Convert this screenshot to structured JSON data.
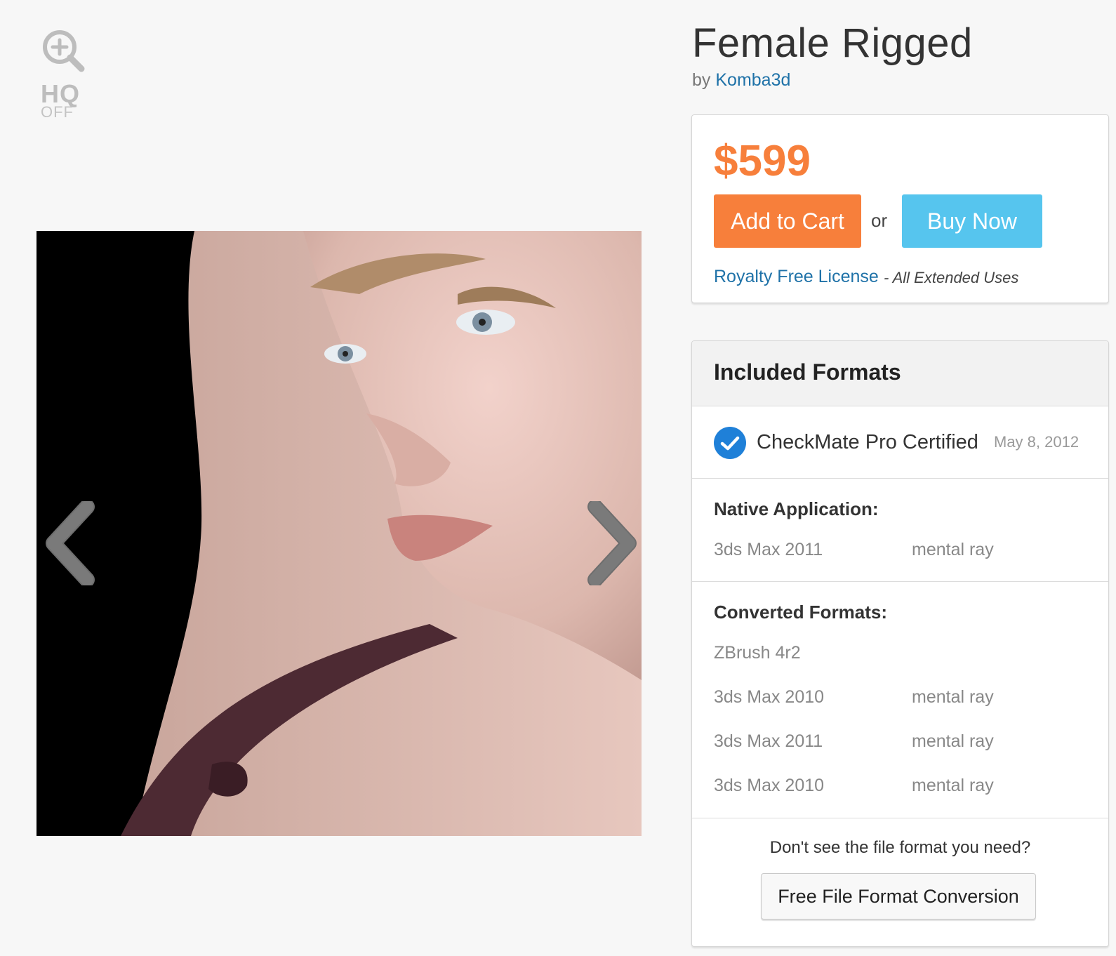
{
  "zoom": {
    "icon": "zoom-in-icon",
    "hq_label": "HQ",
    "hq_state": "OFF"
  },
  "viewer": {
    "prev_icon": "chevron-left-icon",
    "next_icon": "chevron-right-icon"
  },
  "product": {
    "title": "Female Rigged",
    "by": "by",
    "author": "Komba3d"
  },
  "purchase": {
    "price": "$599",
    "add_to_cart": "Add to Cart",
    "or": "or",
    "buy_now": "Buy Now",
    "license": "Royalty Free License",
    "license_note": "- All Extended Uses",
    "colors": {
      "accent_orange": "#f77f3b",
      "accent_blue": "#56c5ee",
      "link": "#1f72a8"
    }
  },
  "formats": {
    "title": "Included Formats",
    "certification": {
      "icon": "check-circle-icon",
      "label": "CheckMate Pro Certified",
      "date": "May 8, 2012"
    },
    "native": {
      "title": "Native Application:",
      "rows": [
        {
          "name": "3ds Max 2011",
          "renderer": "mental ray"
        }
      ]
    },
    "converted": {
      "title": "Converted Formats:",
      "rows": [
        {
          "name": "ZBrush 4r2",
          "renderer": ""
        },
        {
          "name": "3ds Max 2010",
          "renderer": "mental ray"
        },
        {
          "name": "3ds Max 2011",
          "renderer": "mental ray"
        },
        {
          "name": "3ds Max 2010",
          "renderer": "mental ray"
        }
      ]
    },
    "conversion_question": "Don't see the file format you need?",
    "conversion_button": "Free File Format Conversion"
  }
}
